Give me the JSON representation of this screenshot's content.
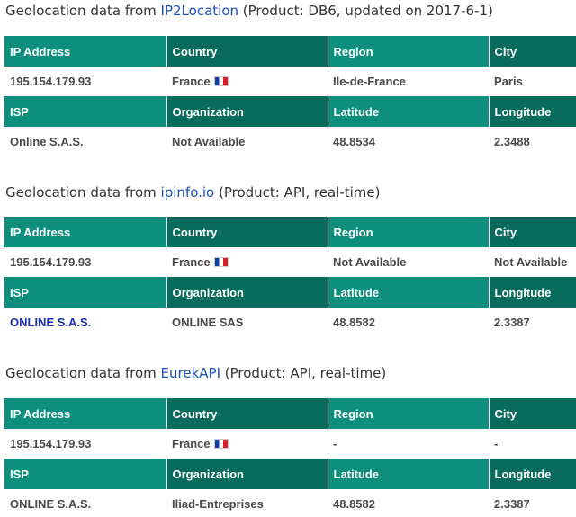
{
  "sections": [
    {
      "title_prefix": "Geolocation data from ",
      "provider": "IP2Location",
      "title_suffix": " (Product: DB6, updated on 2017-6-1)",
      "headers1": [
        "IP Address",
        "Country",
        "Region",
        "City"
      ],
      "row1": {
        "ip": "195.154.179.93",
        "country": "France",
        "region": "Ile-de-France",
        "city": "Paris"
      },
      "headers2": [
        "ISP",
        "Organization",
        "Latitude",
        "Longitude"
      ],
      "row2": {
        "isp": "Online S.A.S.",
        "organization": "Not Available",
        "latitude": "48.8534",
        "longitude": "2.3488"
      }
    },
    {
      "title_prefix": "Geolocation data from ",
      "provider": "ipinfo.io",
      "title_suffix": " (Product: API, real-time)",
      "headers1": [
        "IP Address",
        "Country",
        "Region",
        "City"
      ],
      "row1": {
        "ip": "195.154.179.93",
        "country": "France",
        "region": "Not Available",
        "city": "Not Available"
      },
      "headers2": [
        "ISP",
        "Organization",
        "Latitude",
        "Longitude"
      ],
      "row2": {
        "isp": "ONLINE S.A.S.",
        "organization": "ONLINE SAS",
        "latitude": "48.8582",
        "longitude": "2.3387"
      }
    },
    {
      "title_prefix": "Geolocation data from ",
      "provider": "EurekAPI",
      "title_suffix": " (Product: API, real-time)",
      "headers1": [
        "IP Address",
        "Country",
        "Region",
        "City"
      ],
      "row1": {
        "ip": "195.154.179.93",
        "country": "France",
        "region": "-",
        "city": "-"
      },
      "headers2": [
        "ISP",
        "Organization",
        "Latitude",
        "Longitude"
      ],
      "row2": {
        "isp": "ONLINE S.A.S.",
        "organization": "Iliad-Entreprises",
        "latitude": "48.8582",
        "longitude": "2.3387"
      }
    }
  ],
  "colors": {
    "header_light": "#0e8f7d",
    "header_dark": "#096b5c",
    "link": "#1a4fb8",
    "text": "#4a4a4a"
  },
  "icons": {
    "country_flag": "france-flag-icon"
  }
}
